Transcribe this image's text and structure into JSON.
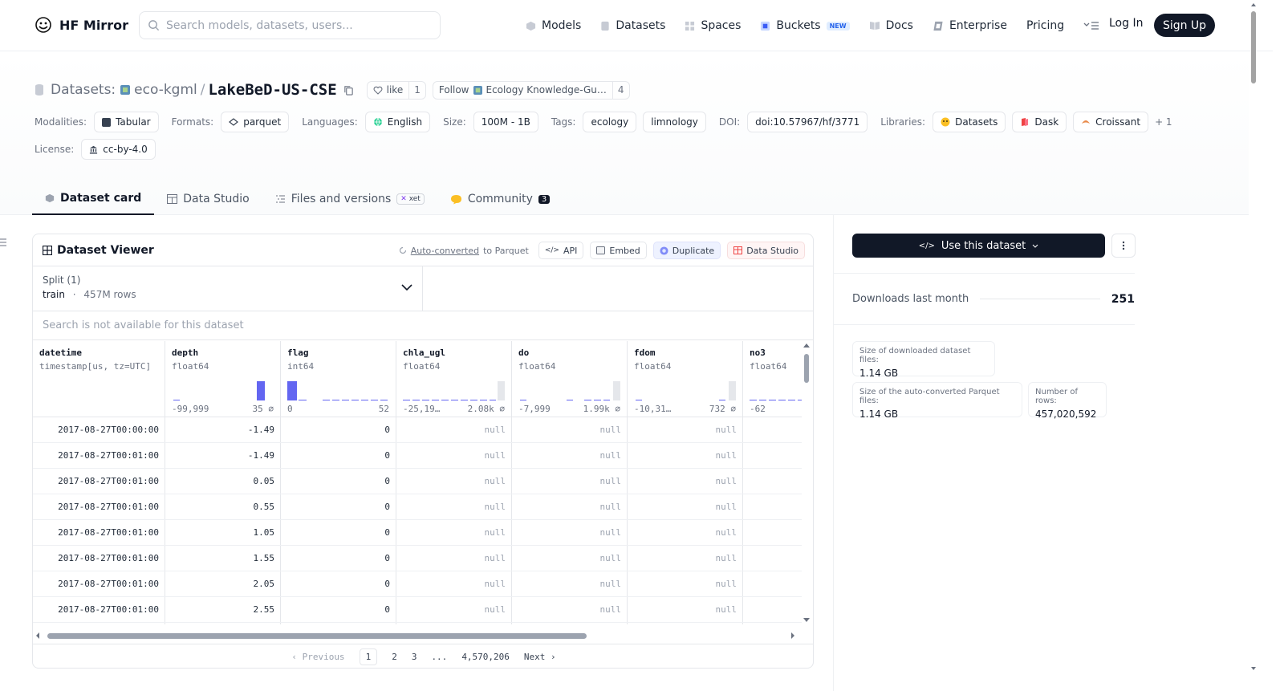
{
  "brand": {
    "name": "HF Mirror"
  },
  "search": {
    "placeholder": "Search models, datasets, users..."
  },
  "nav": {
    "items": [
      {
        "label": "Models",
        "icon": "model-cube-icon"
      },
      {
        "label": "Datasets",
        "icon": "dataset-icon"
      },
      {
        "label": "Spaces",
        "icon": "spaces-grid-icon"
      },
      {
        "label": "Buckets",
        "icon": "bucket-icon",
        "badge": "NEW"
      },
      {
        "label": "Docs",
        "icon": "book-icon"
      },
      {
        "label": "Enterprise",
        "icon": "enterprise-icon"
      },
      {
        "label": "Pricing"
      }
    ],
    "login": "Log In",
    "signup": "Sign Up"
  },
  "repo": {
    "type_label": "Datasets:",
    "org": "eco-kgml",
    "slash": "/",
    "name": "LakeBeD-US-CSE",
    "like_label": "like",
    "like_count": "1",
    "follow_label": "Follow",
    "follow_org": "Ecology Knowledge-Gu…",
    "follow_count": "4"
  },
  "meta": {
    "modalities_label": "Modalities:",
    "modality": "Tabular",
    "formats_label": "Formats:",
    "format": "parquet",
    "languages_label": "Languages:",
    "language": "English",
    "size_label": "Size:",
    "size": "100M - 1B",
    "tags_label": "Tags:",
    "tags": [
      "ecology",
      "limnology"
    ],
    "doi_label": "DOI:",
    "doi": "doi:10.57967/hf/3771",
    "libraries_label": "Libraries:",
    "libraries": [
      "Datasets",
      "Dask",
      "Croissant"
    ],
    "libraries_more": "+ 1",
    "license_label": "License:",
    "license": "cc-by-4.0"
  },
  "tabs": [
    {
      "label": "Dataset card",
      "active": true
    },
    {
      "label": "Data Studio"
    },
    {
      "label": "Files and versions",
      "badge": "xet"
    },
    {
      "label": "Community",
      "count": "3"
    }
  ],
  "viewer": {
    "title": "Dataset Viewer",
    "auto_link": "Auto-converted",
    "auto_rest": "to Parquet",
    "api": "API",
    "embed": "Embed",
    "duplicate": "Duplicate",
    "studio": "Data Studio",
    "split_label": "Split (1)",
    "split_name": "train",
    "split_sep": "·",
    "split_rows": "457M rows",
    "search_na": "Search is not available for this dataset",
    "columns": [
      {
        "name": "datetime",
        "type": "timestamp[us, tz=UTC]"
      },
      {
        "name": "depth",
        "type": "float64",
        "min": "-99,999",
        "max": "35"
      },
      {
        "name": "flag",
        "type": "int64",
        "min": "0",
        "max": "52"
      },
      {
        "name": "chla_ugl",
        "type": "float64",
        "min": "-25,19…",
        "max": "2.08k"
      },
      {
        "name": "do",
        "type": "float64",
        "min": "-7,999",
        "max": "1.99k"
      },
      {
        "name": "fdom",
        "type": "float64",
        "min": "-10,31…",
        "max": "732"
      },
      {
        "name": "no3",
        "type": "float64",
        "min": "-62",
        "max": ""
      }
    ],
    "rows": [
      [
        "2017-08-27T00:00:00",
        "-1.49",
        "0",
        "null",
        "null",
        "null"
      ],
      [
        "2017-08-27T00:01:00",
        "-1.49",
        "0",
        "null",
        "null",
        "null"
      ],
      [
        "2017-08-27T00:01:00",
        "0.05",
        "0",
        "null",
        "null",
        "null"
      ],
      [
        "2017-08-27T00:01:00",
        "0.55",
        "0",
        "null",
        "null",
        "null"
      ],
      [
        "2017-08-27T00:01:00",
        "1.05",
        "0",
        "null",
        "null",
        "null"
      ],
      [
        "2017-08-27T00:01:00",
        "1.55",
        "0",
        "null",
        "null",
        "null"
      ],
      [
        "2017-08-27T00:01:00",
        "2.05",
        "0",
        "null",
        "null",
        "null"
      ],
      [
        "2017-08-27T00:01:00",
        "2.55",
        "0",
        "null",
        "null",
        "null"
      ]
    ],
    "pager": {
      "prev": "Previous",
      "pages": [
        "1",
        "2",
        "3",
        "..."
      ],
      "last": "4,570,206",
      "next": "Next"
    }
  },
  "sidebar": {
    "use_label": "Use this dataset",
    "downloads_label": "Downloads last month",
    "downloads_value": "251",
    "dl_size_label": "Size of downloaded dataset files:",
    "dl_size_value": "1.14 GB",
    "pq_size_label": "Size of the auto-converted Parquet files:",
    "pq_size_value": "1.14 GB",
    "rows_label": "Number of rows:",
    "rows_value": "457,020,592"
  },
  "colors": {
    "accent": "#111827",
    "hist": "#6366f1",
    "hist_bg": "#e5e7eb"
  }
}
